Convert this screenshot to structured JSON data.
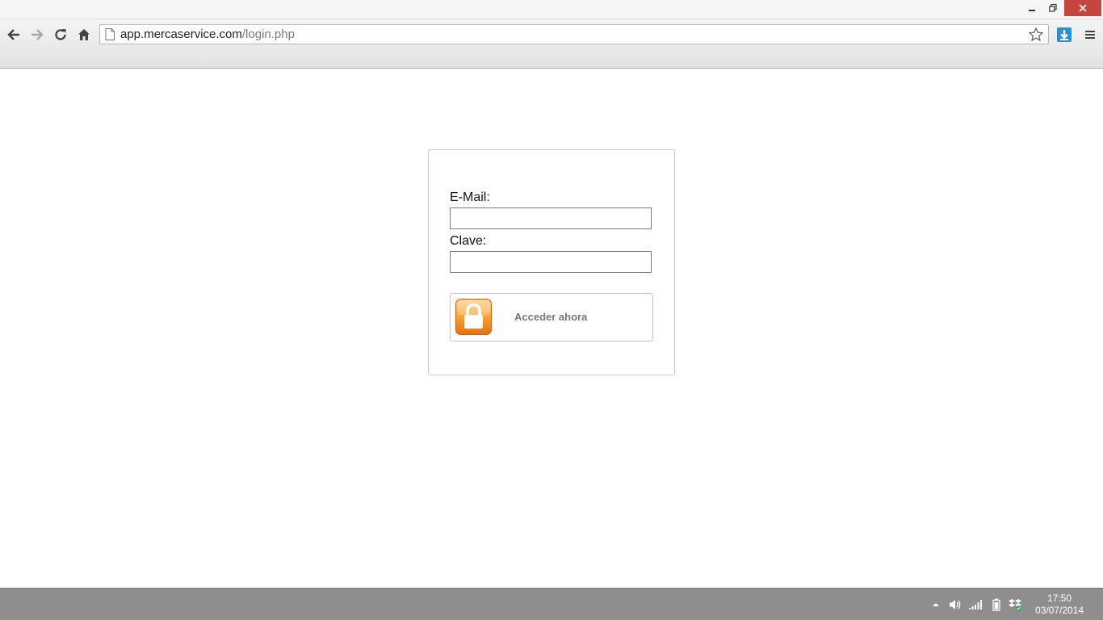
{
  "window": {
    "minimize_icon": "minimize-icon",
    "restore_icon": "restore-icon",
    "close_icon": "close-icon",
    "close_color": "#c7453f"
  },
  "toolbar": {
    "url_domain": "app.mercaservice.com",
    "url_path": "/login.php",
    "icons": [
      "back-arrow-icon",
      "forward-arrow-icon",
      "reload-icon",
      "home-icon",
      "page-icon",
      "star-icon",
      "download-icon",
      "menu-icon"
    ]
  },
  "login": {
    "email_label": "E-Mail:",
    "email_value": "",
    "password_label": "Clave:",
    "password_value": "",
    "button_label": "Acceder ahora",
    "button_icon": "lock-icon",
    "accent_color": "#f29a3f"
  },
  "taskbar": {
    "time": "17:50",
    "date": "03/07/2014",
    "tray_icons": [
      "show-hidden-icons-chevron-icon",
      "volume-icon",
      "network-signal-icon",
      "battery-icon",
      "dropbox-icon"
    ]
  }
}
